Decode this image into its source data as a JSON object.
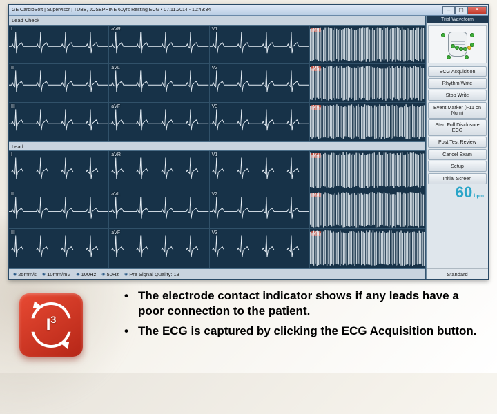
{
  "titlebar": {
    "text": "GE CardioSoft | Supervisor | TUBB, JOSEPHINE 60yrs   Resting ECG • 07.11.2014 - 10:49:34"
  },
  "leadcheck_label": "Lead Check",
  "mid_label": "Lead",
  "leads_upper": [
    [
      "I",
      "aVR",
      "V1",
      "V4"
    ],
    [
      "II",
      "aVL",
      "V2",
      "V5"
    ],
    [
      "III",
      "aVF",
      "V3",
      "V6"
    ]
  ],
  "leads_lower": [
    [
      "I",
      "aVR",
      "V1",
      "V4"
    ],
    [
      "II",
      "aVL",
      "V2",
      "V5"
    ],
    [
      "III",
      "aVF",
      "V3",
      "V6"
    ]
  ],
  "noisy_tags": [
    "V4",
    "V5",
    "V6"
  ],
  "sidebar": {
    "header": "Trial Waveform",
    "hr_value": "60",
    "hr_unit": "bpm",
    "buttons": [
      "ECG Acquisition",
      "Rhythm Write",
      "Stop Write",
      "Event Marker (F11 on Num)",
      "Start Full Disclosure ECG",
      "Post Test Review",
      "Cancel Exam",
      "Setup",
      "Initial Screen"
    ],
    "footer": "Standard"
  },
  "bottombar": {
    "items": [
      "25mm/s",
      "10mm/mV",
      "100Hz",
      "50Hz",
      "Pre Signal Quality: 13"
    ]
  },
  "bullets": [
    "The electrode contact indicator shows if any leads have a poor connection to the patient.",
    "The ECG is captured by clicking the ECG Acquisition button."
  ],
  "badge": {
    "symbol": "I",
    "exponent": "3"
  }
}
